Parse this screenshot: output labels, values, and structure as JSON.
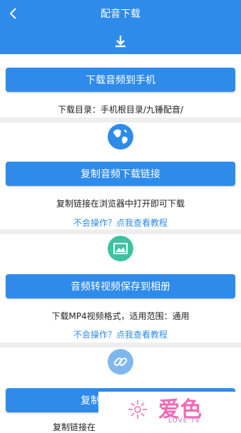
{
  "header": {
    "title": "配音下载"
  },
  "sections": [
    {
      "icon": "download-icon",
      "button": "下载音频到手机",
      "info": "下载目录：手机根目录/九锤配音/"
    },
    {
      "icon": "globe-icon",
      "button": "复制音频下载链接",
      "info": "复制链接在浏览器中打开即可下载",
      "tutorial": "不会操作？点我查看教程"
    },
    {
      "icon": "image-icon",
      "button": "音频转视频保存到相册",
      "info": "下载MP4视频格式，适用范围：通用",
      "tutorial": "不会操作？点我查看教程"
    },
    {
      "icon": "link-icon",
      "button": "复制",
      "info": "复制链接在"
    }
  ],
  "watermark": {
    "main": "爱色",
    "sub": "LOVE TV"
  },
  "colors": {
    "primary": "#2e8bea",
    "teal": "#3cc3a2",
    "link_icon_bg": "#7fb8ee"
  }
}
